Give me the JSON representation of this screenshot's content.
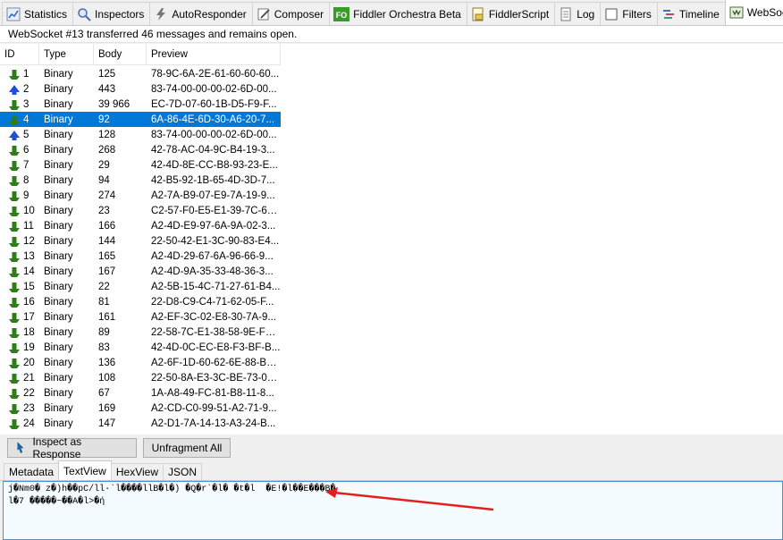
{
  "tabs": [
    {
      "label": "Statistics",
      "icon": "statistics-icon"
    },
    {
      "label": "Inspectors",
      "icon": "inspectors-icon"
    },
    {
      "label": "AutoResponder",
      "icon": "lightning-icon"
    },
    {
      "label": "Composer",
      "icon": "composer-icon"
    },
    {
      "label": "Fiddler Orchestra Beta",
      "icon": "fo-icon"
    },
    {
      "label": "FiddlerScript",
      "icon": "script-icon"
    },
    {
      "label": "Log",
      "icon": "log-icon"
    },
    {
      "label": "Filters",
      "icon": "checkbox-icon"
    },
    {
      "label": "Timeline",
      "icon": "timeline-icon"
    },
    {
      "label": "WebSocket",
      "icon": "websocket-icon"
    }
  ],
  "fo_badge": "FO",
  "status_text": "WebSocket #13 transferred 46 messages and remains open.",
  "columns": {
    "id": "ID",
    "type": "Type",
    "body": "Body",
    "preview": "Preview"
  },
  "messages": [
    {
      "id": "1",
      "dir": "in",
      "type": "Binary",
      "body": "125",
      "preview": "78-9C-6A-2E-61-60-60-60..."
    },
    {
      "id": "2",
      "dir": "out",
      "type": "Binary",
      "body": "443",
      "preview": "83-74-00-00-00-02-6D-00..."
    },
    {
      "id": "3",
      "dir": "in",
      "type": "Binary",
      "body": "39 966",
      "preview": "EC-7D-07-60-1B-D5-F9-F..."
    },
    {
      "id": "4",
      "dir": "in",
      "type": "Binary",
      "body": "92",
      "preview": "6A-86-4E-6D-30-A6-20-7...",
      "selected": true
    },
    {
      "id": "5",
      "dir": "out",
      "type": "Binary",
      "body": "128",
      "preview": "83-74-00-00-00-02-6D-00..."
    },
    {
      "id": "6",
      "dir": "in",
      "type": "Binary",
      "body": "268",
      "preview": "42-78-AC-04-9C-B4-19-3..."
    },
    {
      "id": "7",
      "dir": "in",
      "type": "Binary",
      "body": "29",
      "preview": "42-4D-8E-CC-B8-93-23-E..."
    },
    {
      "id": "8",
      "dir": "in",
      "type": "Binary",
      "body": "94",
      "preview": "42-B5-92-1B-65-4D-3D-7..."
    },
    {
      "id": "9",
      "dir": "in",
      "type": "Binary",
      "body": "274",
      "preview": "A2-7A-B9-07-E9-7A-19-9..."
    },
    {
      "id": "10",
      "dir": "in",
      "type": "Binary",
      "body": "23",
      "preview": "C2-57-F0-E5-E1-39-7C-6E..."
    },
    {
      "id": "11",
      "dir": "in",
      "type": "Binary",
      "body": "166",
      "preview": "A2-4D-E9-97-6A-9A-02-3..."
    },
    {
      "id": "12",
      "dir": "in",
      "type": "Binary",
      "body": "144",
      "preview": "22-50-42-E1-3C-90-83-E4..."
    },
    {
      "id": "13",
      "dir": "in",
      "type": "Binary",
      "body": "165",
      "preview": "A2-4D-29-67-6A-96-66-9..."
    },
    {
      "id": "14",
      "dir": "in",
      "type": "Binary",
      "body": "167",
      "preview": "A2-4D-9A-35-33-48-36-3..."
    },
    {
      "id": "15",
      "dir": "in",
      "type": "Binary",
      "body": "22",
      "preview": "A2-5B-15-4C-71-27-61-B4..."
    },
    {
      "id": "16",
      "dir": "in",
      "type": "Binary",
      "body": "81",
      "preview": "22-D8-C9-C4-71-62-05-F..."
    },
    {
      "id": "17",
      "dir": "in",
      "type": "Binary",
      "body": "161",
      "preview": "A2-EF-3C-02-E8-30-7A-9..."
    },
    {
      "id": "18",
      "dir": "in",
      "type": "Binary",
      "body": "89",
      "preview": "22-58-7C-E1-38-58-9E-FE..."
    },
    {
      "id": "19",
      "dir": "in",
      "type": "Binary",
      "body": "83",
      "preview": "42-4D-0C-EC-E8-F3-BF-B..."
    },
    {
      "id": "20",
      "dir": "in",
      "type": "Binary",
      "body": "136",
      "preview": "A2-6F-1D-60-62-6E-88-B2..."
    },
    {
      "id": "21",
      "dir": "in",
      "type": "Binary",
      "body": "108",
      "preview": "22-50-8A-E3-3C-BE-73-00..."
    },
    {
      "id": "22",
      "dir": "in",
      "type": "Binary",
      "body": "67",
      "preview": "1A-A8-49-FC-81-B8-11-8..."
    },
    {
      "id": "23",
      "dir": "in",
      "type": "Binary",
      "body": "169",
      "preview": "A2-CD-C0-99-51-A2-71-9..."
    },
    {
      "id": "24",
      "dir": "in",
      "type": "Binary",
      "body": "147",
      "preview": "A2-D1-7A-14-13-A3-24-B..."
    }
  ],
  "buttons": {
    "inspect": "Inspect as Response",
    "unfragment": "Unfragment All"
  },
  "subtabs": [
    "Metadata",
    "TextView",
    "HexView",
    "JSON"
  ],
  "active_subtab": "TextView",
  "textview_lines": [
    "j�Nm0� z�)h��pC/ll·`l����llB�l�) �Q�r`�l� �t�l  �E!�l��E���B�",
    "l�7 �����~��A�l>�ή"
  ],
  "colors": {
    "selected": "#0078d7",
    "in_arrow": "#2e7d18",
    "out_arrow": "#1f4fd6",
    "annotation_arrow": "#e02020"
  }
}
